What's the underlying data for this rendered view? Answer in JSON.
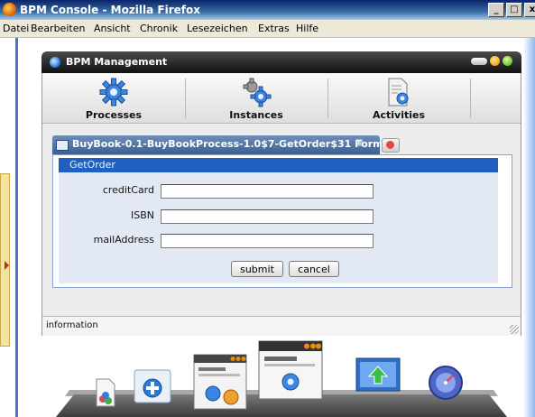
{
  "browser": {
    "title": "BPM Console - Mozilla Firefox",
    "window_buttons": [
      "_",
      "□",
      "x"
    ]
  },
  "menu": [
    "Datei",
    "Bearbeiten",
    "Ansicht",
    "Chronik",
    "Lesezeichen",
    "Extras",
    "Hilfe"
  ],
  "app": {
    "title": "BPM Management",
    "toolbar": [
      {
        "label": "Processes",
        "icon": "gear-icon"
      },
      {
        "label": "Instances",
        "icon": "gears-icon"
      },
      {
        "label": "Activities",
        "icon": "document-gear-icon"
      }
    ]
  },
  "tab": {
    "title": "BuyBook-0.1-BuyBookProcess-1.0$7-GetOrder$31 Form",
    "close_glyph": "⊠"
  },
  "form": {
    "header": "GetOrder",
    "fields": [
      {
        "label": "creditCard",
        "value": ""
      },
      {
        "label": "ISBN",
        "value": ""
      },
      {
        "label": "mailAddress",
        "value": ""
      }
    ],
    "submit_label": "submit",
    "cancel_label": "cancel"
  },
  "status": {
    "text": "information"
  },
  "dock": {
    "icons": [
      "document-icon",
      "help-icon",
      "window-gears-icon",
      "window-gear-icon",
      "monitor-up-icon",
      "globe-icon"
    ]
  },
  "colors": {
    "title_blue": "#0a246a",
    "form_header_blue": "#2060c0",
    "form_area": "#e3e9f4"
  }
}
